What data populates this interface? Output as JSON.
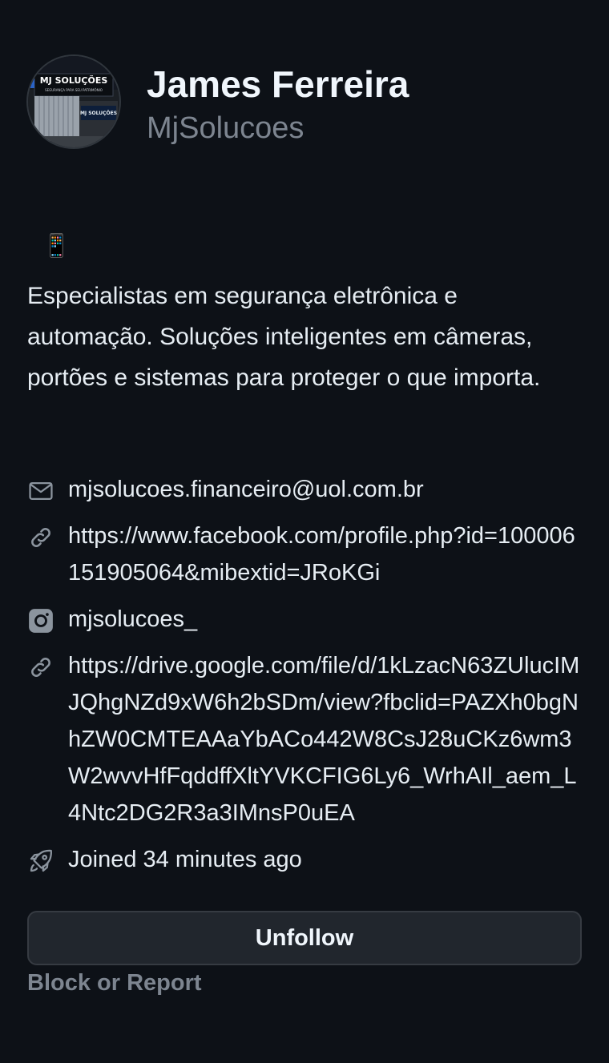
{
  "profile": {
    "display_name": "James Ferreira",
    "username": "MjSolucoes",
    "avatar": {
      "sign_title": "MJ SOLUÇÕES",
      "sign_tagline": "SEGURANÇA PARA SEU PATRIMÔNIO",
      "side_sign": "MJ SOLUÇÕES"
    }
  },
  "bio": {
    "emoji": "📱",
    "text": "Especialistas em segurança eletrônica e automação. Soluções inteligentes em câmeras, portões e sistemas para proteger o que importa."
  },
  "details": {
    "email": {
      "icon": "mail-icon",
      "text": "mjsolucoes.financeiro@uol.com.br"
    },
    "facebook": {
      "icon": "link-icon",
      "text": "https://www.facebook.com/profile.php?id=100006151905064&mibextid=JRoKGi"
    },
    "instagram": {
      "icon": "instagram-icon",
      "text": "mjsolucoes_"
    },
    "drive": {
      "icon": "link-icon",
      "text": "https://drive.google.com/file/d/1kLzacN63ZUlucIMJQhgNZd9xW6h2bSDm/view?fbclid=PAZXh0bgNhZW0CMTEAAaYbACo442W8CsJ28uCKz6wm3W2wvvHfFqddffXltYVKCFIG6Ly6_WrhAIl_aem_L4Ntc2DG2R3a3IMnsP0uEA"
    },
    "joined": {
      "icon": "rocket-icon",
      "text": "Joined 34 minutes ago"
    }
  },
  "actions": {
    "unfollow_label": "Unfollow",
    "block_report_label": "Block or Report"
  },
  "colors": {
    "background": "#0d1117",
    "button_background": "#21262d",
    "muted_text": "#7d8590"
  }
}
